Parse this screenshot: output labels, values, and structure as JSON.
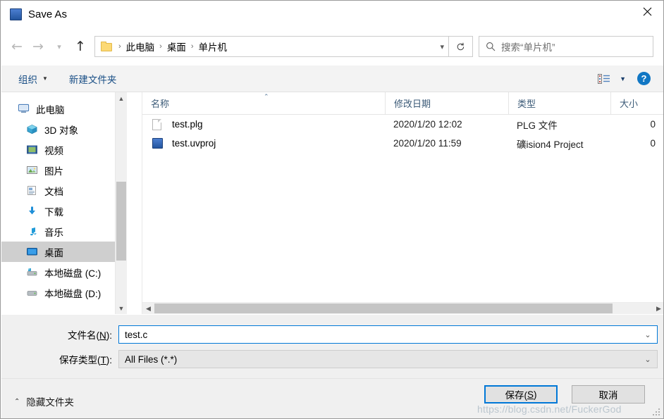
{
  "window": {
    "title": "Save As",
    "icon": "uvision-icon",
    "close_label": "✕"
  },
  "nav": {
    "back_icon": "arrow-left-icon",
    "forward_icon": "arrow-right-icon",
    "history_icon": "chevron-down-icon",
    "up_icon": "arrow-up-icon",
    "refresh_icon": "refresh-icon",
    "breadcrumb": [
      "此电脑",
      "桌面",
      "单片机"
    ],
    "separator": "›",
    "dropdown_icon": "chevron-down-icon"
  },
  "search": {
    "placeholder": "搜索“单片机”",
    "icon": "search-icon"
  },
  "toolbar": {
    "organize_label": "组织",
    "organize_caret": "▼",
    "new_folder_label": "新建文件夹",
    "view_icon": "list-view-icon",
    "view_caret": "▼",
    "help_label": "?"
  },
  "sidebar": {
    "items": [
      {
        "label": "此电脑",
        "icon": "computer-icon",
        "indent": false,
        "selected": false
      },
      {
        "label": "3D 对象",
        "icon": "3d-objects-icon",
        "indent": true,
        "selected": false
      },
      {
        "label": "视频",
        "icon": "videos-icon",
        "indent": true,
        "selected": false
      },
      {
        "label": "图片",
        "icon": "pictures-icon",
        "indent": true,
        "selected": false
      },
      {
        "label": "文档",
        "icon": "documents-icon",
        "indent": true,
        "selected": false
      },
      {
        "label": "下载",
        "icon": "downloads-icon",
        "indent": true,
        "selected": false
      },
      {
        "label": "音乐",
        "icon": "music-icon",
        "indent": true,
        "selected": false
      },
      {
        "label": "桌面",
        "icon": "desktop-icon",
        "indent": true,
        "selected": true
      },
      {
        "label": "本地磁盘 (C:)",
        "icon": "drive-c-icon",
        "indent": true,
        "selected": false
      },
      {
        "label": "本地磁盘 (D:)",
        "icon": "drive-d-icon",
        "indent": true,
        "selected": false
      }
    ],
    "scroll_up_icon": "chevron-up-icon",
    "scroll_down_icon": "chevron-down-icon"
  },
  "filelist": {
    "columns": [
      "名称",
      "修改日期",
      "类型",
      "大小"
    ],
    "sort_caret": "⌃",
    "rows": [
      {
        "name": "test.plg",
        "date": "2020/1/20 12:02",
        "type": "PLG 文件",
        "size": "0",
        "icon": "generic-file-icon"
      },
      {
        "name": "test.uvproj",
        "date": "2020/1/20 11:59",
        "type": "礦ision4 Project",
        "size": "0",
        "icon": "uvision-file-icon"
      }
    ],
    "hscroll_left_icon": "chevron-left-icon",
    "hscroll_right_icon": "chevron-right-icon"
  },
  "form": {
    "filename_label_pre": "文件名(",
    "filename_label_key": "N",
    "filename_label_post": "):",
    "filename_value": "test.c",
    "filetype_label_pre": "保存类型(",
    "filetype_label_key": "T",
    "filetype_label_post": "):",
    "filetype_value": "All Files (*.*)",
    "combo_chevron": "⌄"
  },
  "footer": {
    "hide_folders_label": "隐藏文件夹",
    "hide_folders_chevron": "⌃",
    "save_pre": "保存(",
    "save_key": "S",
    "save_post": ")",
    "cancel_label": "取消",
    "watermark": "https://blog.csdn.net/FuckerGod"
  },
  "colors": {
    "accent": "#0078d7",
    "selection": "#cfcfcf",
    "chrome": "#f0f0f0",
    "link": "#1a4f86"
  }
}
